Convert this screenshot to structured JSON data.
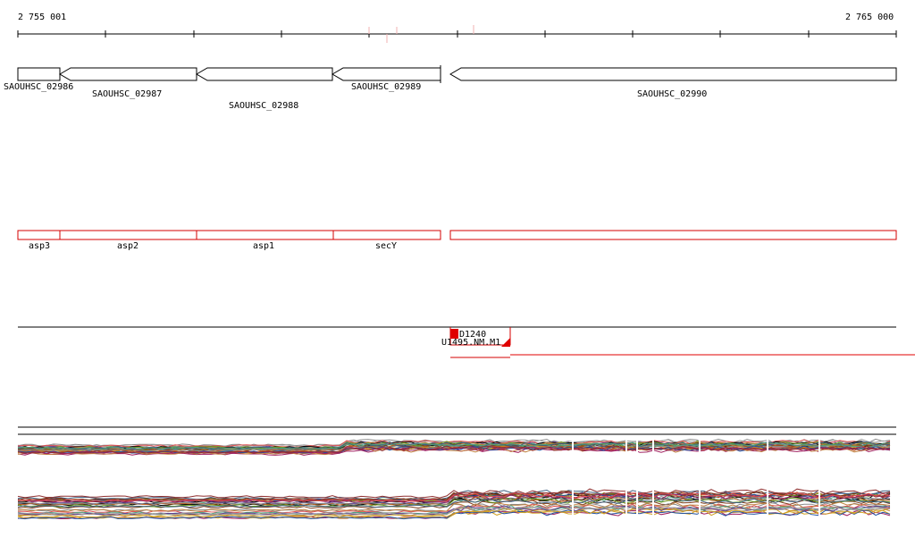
{
  "ruler": {
    "start_label": "2 755 001",
    "end_label": "2 765 000"
  },
  "genes": [
    {
      "name": "SAOUHSC_02986"
    },
    {
      "name": "SAOUHSC_02987"
    },
    {
      "name": "SAOUHSC_02988"
    },
    {
      "name": "SAOUHSC_02989"
    },
    {
      "name": "SAOUHSC_02990"
    }
  ],
  "annotations": [
    {
      "name": "asp3"
    },
    {
      "name": "asp2"
    },
    {
      "name": "asp1"
    },
    {
      "name": "secY"
    },
    {
      "name": ""
    }
  ],
  "features": {
    "feature_a": "D1240",
    "feature_b": "U1495.NM.M1"
  },
  "colors": {
    "gene_stroke": "#000000",
    "annotation_stroke": "#d40000",
    "feature_red": "#e00000",
    "ruler_mark": "#f0a0a0"
  }
}
